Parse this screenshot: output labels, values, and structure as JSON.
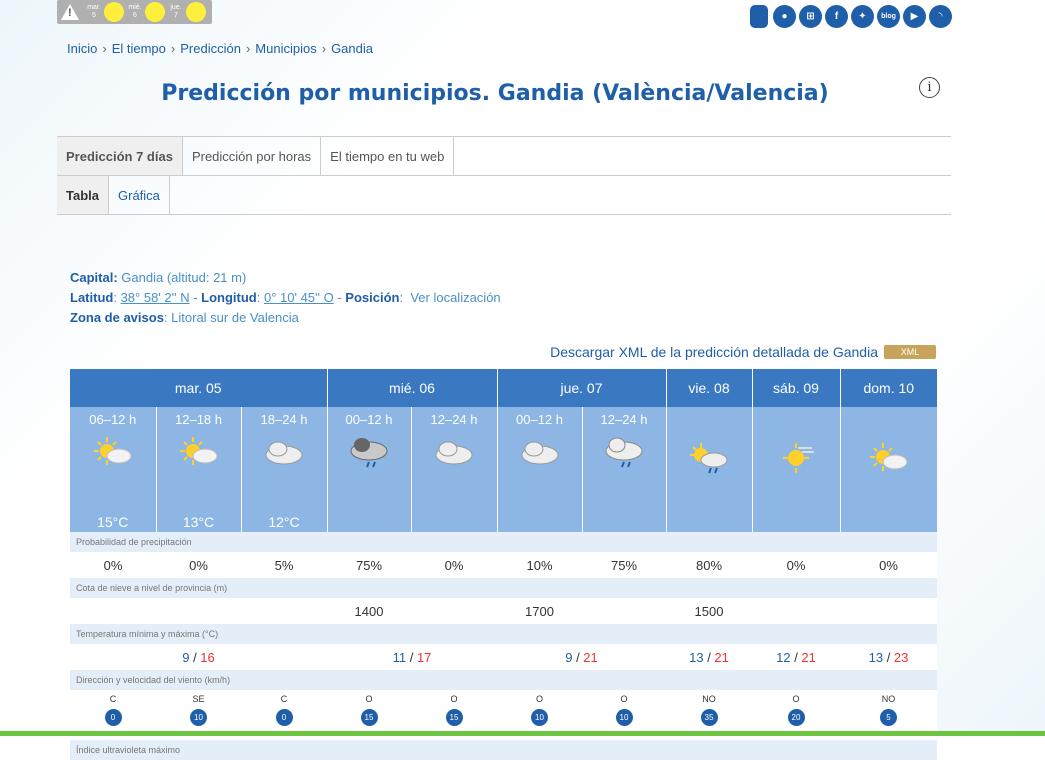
{
  "top_warnings": [
    {
      "day": "mar.",
      "num": "5"
    },
    {
      "day": "mié.",
      "num": "6"
    },
    {
      "day": "jue.",
      "num": "7"
    }
  ],
  "social_icons": [
    "mobile-icon",
    "app-icon",
    "network-icon",
    "facebook-icon",
    "twitter-icon",
    "blog-icon",
    "youtube-icon",
    "rss-icon"
  ],
  "social_text": {
    "facebook": "f",
    "blog": "blog"
  },
  "breadcrumb": [
    "Inicio",
    "El tiempo",
    "Predicción",
    "Municipios",
    "Gandia"
  ],
  "page_title": "Predicción por municipios. Gandia (València/Valencia)",
  "tabs_main": [
    "Predicción 7 días",
    "Predicción por horas",
    "El tiempo en tu web"
  ],
  "tabs_sub": [
    "Tabla",
    "Gráfica"
  ],
  "capital": {
    "capital_label": "Capital:",
    "capital_value": "Gandia (altitud: 21 m)",
    "lat_label": "Latitud",
    "lat_value": "38° 58' 2'' N",
    "lon_label": "Longitud",
    "lon_value": "0° 10' 45'' O",
    "pos_label": "Posición",
    "pos_value": "Ver localización",
    "zona_label": "Zona de avisos",
    "zona_value": "Litoral sur de Valencia"
  },
  "xml": {
    "text": "Descargar XML de la predicción detallada de Gandia",
    "badge": "XML"
  },
  "days": [
    {
      "label": "mar. 05",
      "span": 3
    },
    {
      "label": "mié. 06",
      "span": 2
    },
    {
      "label": "jue. 07",
      "span": 2
    },
    {
      "label": "vie. 08",
      "span": 1
    },
    {
      "label": "sáb. 09",
      "span": 1
    },
    {
      "label": "dom. 10",
      "span": 1
    }
  ],
  "periods": [
    {
      "label": "06–12 h",
      "icon": "sun-cloud",
      "temp": "15°C"
    },
    {
      "label": "12–18 h",
      "icon": "sun-cloud",
      "temp": "13°C"
    },
    {
      "label": "18–24 h",
      "icon": "cloud",
      "temp": "12°C"
    },
    {
      "label": "00–12 h",
      "icon": "cloud-rain-dark",
      "temp": ""
    },
    {
      "label": "12–24 h",
      "icon": "cloud",
      "temp": ""
    },
    {
      "label": "00–12 h",
      "icon": "cloud",
      "temp": ""
    },
    {
      "label": "12–24 h",
      "icon": "cloud-rain",
      "temp": ""
    },
    {
      "label": "",
      "icon": "sun-cloud-rain",
      "temp": ""
    },
    {
      "label": "",
      "icon": "sun-haze",
      "temp": ""
    },
    {
      "label": "",
      "icon": "sun-cloud",
      "temp": ""
    }
  ],
  "labels": {
    "precip": "Probabilidad de precipitación",
    "snow": "Cota de nieve a nivel de provincia (m)",
    "temp": "Temperatura mínima y máxima (°C)",
    "wind": "Dirección y velocidad del viento (km/h)",
    "uv": "Índice ultravioleta máximo"
  },
  "precip": [
    "0%",
    "0%",
    "5%",
    "75%",
    "0%",
    "10%",
    "75%",
    "80%",
    "0%",
    "0%"
  ],
  "snow": [
    "",
    "",
    "",
    "1400",
    "",
    "1700",
    "",
    "1500",
    "",
    ""
  ],
  "temps": [
    {
      "min": "9",
      "max": "16"
    },
    {
      "min": "11",
      "max": "17"
    },
    {
      "min": "9",
      "max": "21"
    },
    {
      "min": "13",
      "max": "21"
    },
    {
      "min": "12",
      "max": "21"
    },
    {
      "min": "13",
      "max": "23"
    }
  ],
  "temp_sep": " / ",
  "wind": [
    {
      "dir": "C",
      "speed": "0"
    },
    {
      "dir": "SE",
      "speed": "10"
    },
    {
      "dir": "C",
      "speed": "0"
    },
    {
      "dir": "O",
      "speed": "15"
    },
    {
      "dir": "O",
      "speed": "15"
    },
    {
      "dir": "O",
      "speed": "10"
    },
    {
      "dir": "O",
      "speed": "10"
    },
    {
      "dir": "NO",
      "speed": "35"
    },
    {
      "dir": "O",
      "speed": "20"
    },
    {
      "dir": "NO",
      "speed": "5"
    }
  ],
  "colors": {
    "primary": "#1f5ea8",
    "header": "#3a78c2",
    "period_bg": "#8db6e4",
    "max": "#e33333",
    "warn_yellow": "#ffef3d"
  }
}
